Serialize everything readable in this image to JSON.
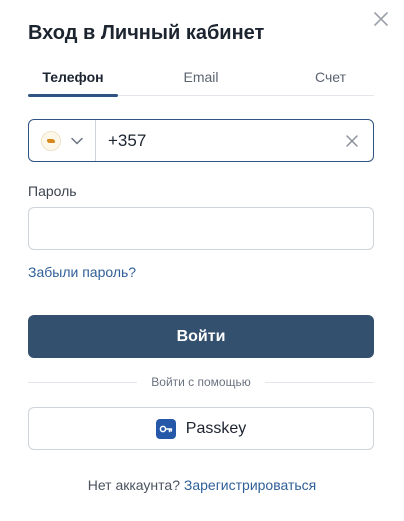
{
  "dialog": {
    "title": "Вход в Личный кабинет"
  },
  "tabs": [
    {
      "label": "Телефон",
      "active": true
    },
    {
      "label": "Email",
      "active": false
    },
    {
      "label": "Счет",
      "active": false
    }
  ],
  "phone": {
    "country_icon": "cyprus-flag-icon",
    "value": "+357"
  },
  "password": {
    "label": "Пароль",
    "value": ""
  },
  "forgot_link": "Забыли пароль?",
  "login_button": "Войти",
  "divider_text": "Войти с помощью",
  "passkey_button": {
    "label": "Passkey",
    "icon": "key-icon"
  },
  "footer": {
    "question": "Нет аккаунта?",
    "register_link": "Зарегистрироваться"
  },
  "colors": {
    "primary": "#34506f",
    "accent_border": "#2f5483",
    "link": "#2f5f99",
    "passkey_icon_bg": "#2558a8"
  }
}
